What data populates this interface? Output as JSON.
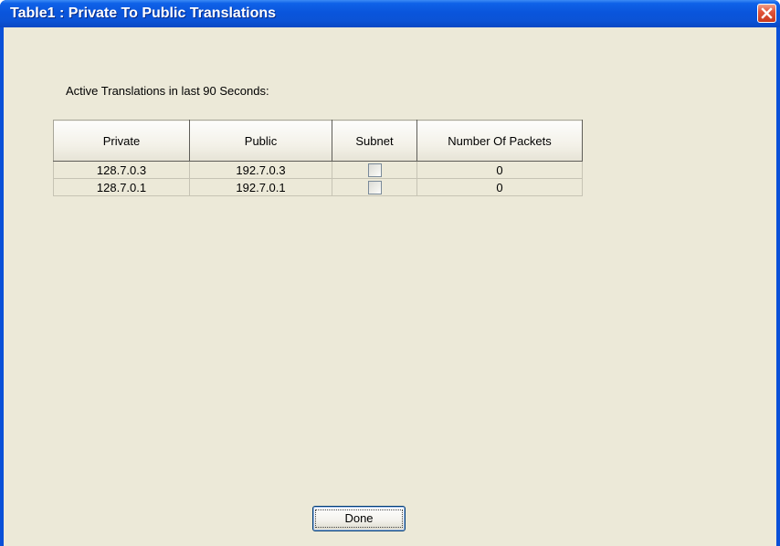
{
  "window": {
    "title": "Table1 : Private To Public Translations",
    "close_icon": "close-icon",
    "title_color": "#0a55dc",
    "client_color": "#ece9d8"
  },
  "caption": "Active Translations in last 90 Seconds:",
  "table": {
    "columns": [
      "Private",
      "Public",
      "Subnet",
      "Number Of Packets"
    ],
    "rows": [
      {
        "private": "128.7.0.3",
        "public": "192.7.0.3",
        "subnet": false,
        "packets": "0"
      },
      {
        "private": "128.7.0.1",
        "public": "192.7.0.1",
        "subnet": false,
        "packets": "0"
      }
    ]
  },
  "buttons": {
    "done_label": "Done"
  }
}
